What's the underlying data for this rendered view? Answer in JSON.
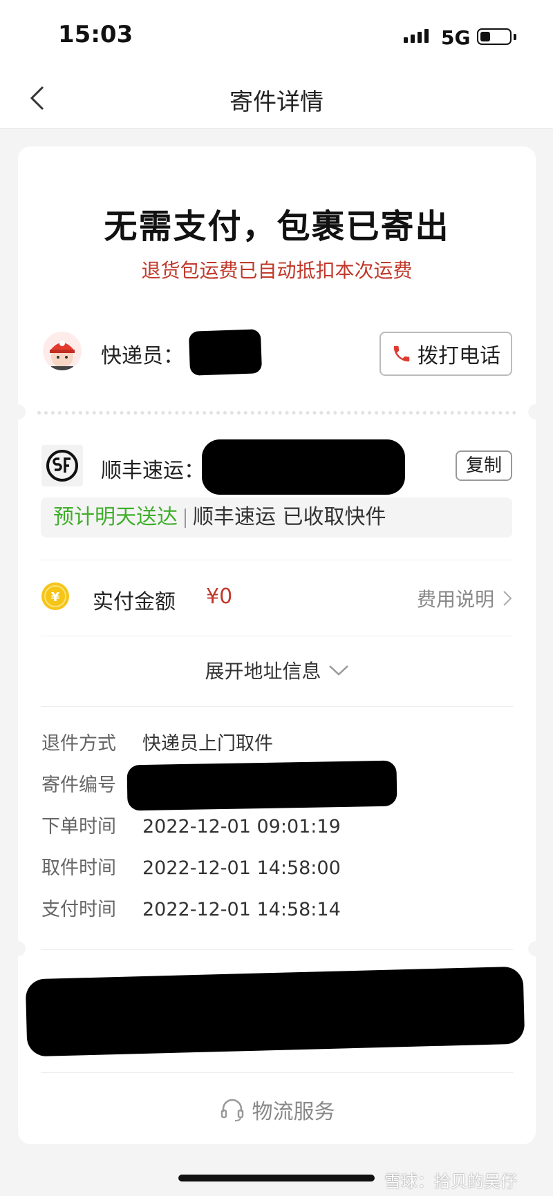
{
  "status_bar": {
    "time": "15:03",
    "network": "5G",
    "battery_level": 0.35
  },
  "nav": {
    "title": "寄件详情",
    "back_icon": "chevron-left-icon"
  },
  "summary": {
    "headline": "无需支付，包裹已寄出",
    "subline": "退货包运费已自动抵扣本次运费"
  },
  "courier": {
    "label": "快递员：",
    "call_label": "拨打电话",
    "call_icon": "phone-icon"
  },
  "shipment": {
    "carrier_label": "顺丰速运：",
    "copy_label": "复制",
    "eta": "预计明天送达",
    "status": "顺丰速运 已收取快件"
  },
  "payment": {
    "label": "实付金额",
    "amount": "¥0",
    "fee_link": "费用说明",
    "coin_icon": "yuan-coin-icon"
  },
  "expand_label": "展开地址信息",
  "details": [
    {
      "key": "退件方式",
      "value": "快递员上门取件"
    },
    {
      "key": "寄件编号",
      "value": ""
    },
    {
      "key": "下单时间",
      "value": "2022-12-01 09:01:19"
    },
    {
      "key": "取件时间",
      "value": "2022-12-01 14:58:00"
    },
    {
      "key": "支付时间",
      "value": "2022-12-01 14:58:14"
    }
  ],
  "service_label": "物流服务",
  "watermark": "雪球：拾贝的吴仔",
  "colors": {
    "accent_red": "#c0392b",
    "eta_green": "#3fae2a"
  }
}
